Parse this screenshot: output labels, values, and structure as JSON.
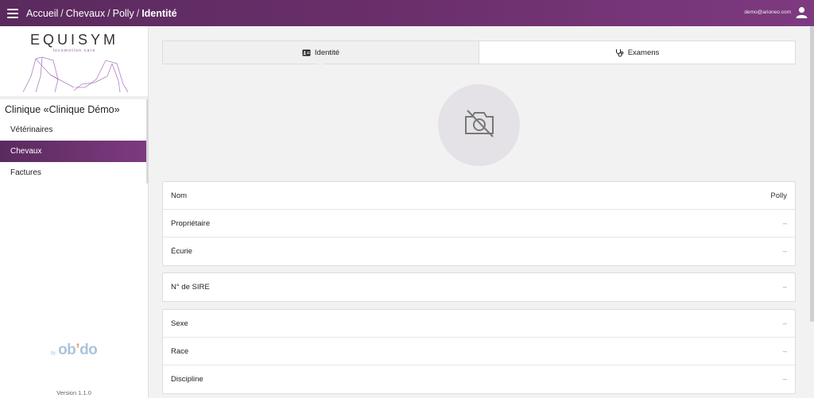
{
  "topbar": {
    "breadcrumb": [
      "Accueil",
      "Chevaux",
      "Polly"
    ],
    "current": "Identité",
    "user_email": "demo@arioneo.com"
  },
  "sidebar": {
    "logo_text": "EQUISYM",
    "logo_sub": "locomotion care",
    "clinic_title": "Clinique «Clinique Démo»",
    "items": [
      {
        "label": "Vétérinaires",
        "active": false
      },
      {
        "label": "Chevaux",
        "active": true
      },
      {
        "label": "Factures",
        "active": false
      }
    ],
    "footer_by": "by",
    "footer_brand_1": "ob",
    "footer_brand_apos": "’",
    "footer_brand_2": "do",
    "version": "Version 1.1.0"
  },
  "tabs": [
    {
      "label": "Identité",
      "icon": "id-card-icon",
      "active": true
    },
    {
      "label": "Examens",
      "icon": "stethoscope-icon",
      "active": false
    }
  ],
  "photo": {
    "icon": "camera-off-icon"
  },
  "identity": {
    "card1": [
      {
        "label": "Nom",
        "value": "Polly"
      },
      {
        "label": "Propriétaire",
        "value": "–"
      },
      {
        "label": "Écurie",
        "value": "–"
      }
    ],
    "card2": [
      {
        "label": "N° de SIRE",
        "value": "–"
      }
    ],
    "card3": [
      {
        "label": "Sexe",
        "value": "–"
      },
      {
        "label": "Race",
        "value": "–"
      },
      {
        "label": "Discipline",
        "value": "–"
      }
    ]
  },
  "colors": {
    "brand": "#6b2f6c",
    "accent_light": "#aac4dd",
    "accent_orange": "#e9a25a"
  }
}
